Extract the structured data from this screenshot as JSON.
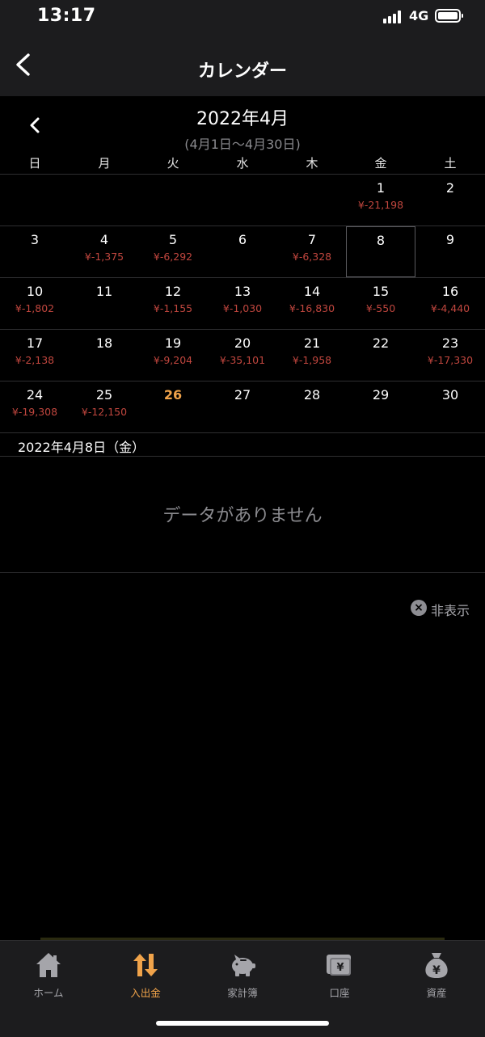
{
  "status": {
    "time": "13:17",
    "network": "4G"
  },
  "header": {
    "title": "カレンダー"
  },
  "month": {
    "title": "2022年4月",
    "range": "(4月1日〜4月30日)"
  },
  "weekdays": [
    "日",
    "月",
    "火",
    "水",
    "木",
    "金",
    "土"
  ],
  "weeks": [
    [
      {
        "day": "",
        "amount": ""
      },
      {
        "day": "",
        "amount": ""
      },
      {
        "day": "",
        "amount": ""
      },
      {
        "day": "",
        "amount": ""
      },
      {
        "day": "",
        "amount": ""
      },
      {
        "day": "1",
        "amount": "¥-21,198"
      },
      {
        "day": "2",
        "amount": ""
      }
    ],
    [
      {
        "day": "3",
        "amount": ""
      },
      {
        "day": "4",
        "amount": "¥-1,375"
      },
      {
        "day": "5",
        "amount": "¥-6,292"
      },
      {
        "day": "6",
        "amount": ""
      },
      {
        "day": "7",
        "amount": "¥-6,328"
      },
      {
        "day": "8",
        "amount": "",
        "selected": true
      },
      {
        "day": "9",
        "amount": ""
      }
    ],
    [
      {
        "day": "10",
        "amount": "¥-1,802"
      },
      {
        "day": "11",
        "amount": ""
      },
      {
        "day": "12",
        "amount": "¥-1,155"
      },
      {
        "day": "13",
        "amount": "¥-1,030"
      },
      {
        "day": "14",
        "amount": "¥-16,830"
      },
      {
        "day": "15",
        "amount": "¥-550"
      },
      {
        "day": "16",
        "amount": "¥-4,440"
      }
    ],
    [
      {
        "day": "17",
        "amount": "¥-2,138"
      },
      {
        "day": "18",
        "amount": ""
      },
      {
        "day": "19",
        "amount": "¥-9,204"
      },
      {
        "day": "20",
        "amount": "¥-35,101"
      },
      {
        "day": "21",
        "amount": "¥-1,958"
      },
      {
        "day": "22",
        "amount": ""
      },
      {
        "day": "23",
        "amount": "¥-17,330"
      }
    ],
    [
      {
        "day": "24",
        "amount": "¥-19,308"
      },
      {
        "day": "25",
        "amount": "¥-12,150"
      },
      {
        "day": "26",
        "amount": "",
        "today": true
      },
      {
        "day": "27",
        "amount": ""
      },
      {
        "day": "28",
        "amount": ""
      },
      {
        "day": "29",
        "amount": ""
      },
      {
        "day": "30",
        "amount": ""
      }
    ]
  ],
  "detail": {
    "date": "2022年4月8日（金）",
    "empty_message": "データがありません"
  },
  "hide_button": {
    "label": "非表示"
  },
  "tabs": [
    {
      "label": "ホーム",
      "icon": "home-icon"
    },
    {
      "label": "入出金",
      "icon": "transfer-arrows-icon",
      "active": true
    },
    {
      "label": "家計簿",
      "icon": "piggy-bank-icon"
    },
    {
      "label": "口座",
      "icon": "wallet-yen-icon"
    },
    {
      "label": "資産",
      "icon": "money-bag-yen-icon"
    }
  ],
  "colors": {
    "accent": "#f0a34a",
    "expense": "#c0463e",
    "muted": "#8a8a8e"
  }
}
